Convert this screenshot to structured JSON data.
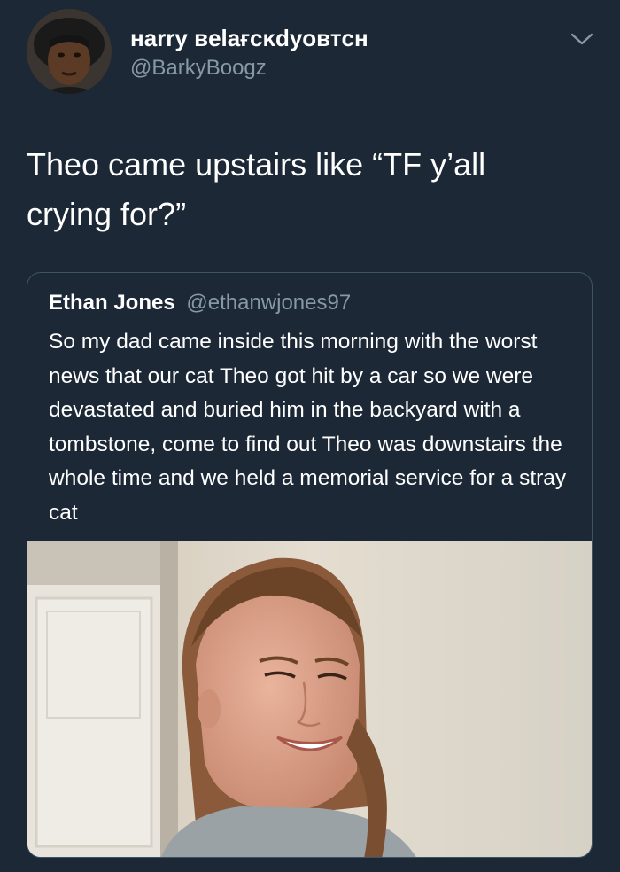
{
  "tweet": {
    "author_name": "нarry вelaғcĸdyoвтcн",
    "author_handle": "@BarkyBoogz",
    "text": "Theo came upstairs like “TF y’all crying for?”",
    "menu_icon": "chevron-down-icon"
  },
  "quoted_tweet": {
    "author_name": "Ethan Jones",
    "author_handle": "@ethanwjones97",
    "text": "So my dad came inside this morning with the worst news that our cat Theo got hit by a car so we were devastated and buried him in the backyard with a tombstone, come to find out Theo was downstairs the whole time and we held a memorial service for a stray cat",
    "media": "photo of smiling young woman"
  },
  "colors": {
    "background": "#1c2836",
    "text_primary": "#ffffff",
    "text_secondary": "#8899a6",
    "card_border": "#3d5466"
  }
}
